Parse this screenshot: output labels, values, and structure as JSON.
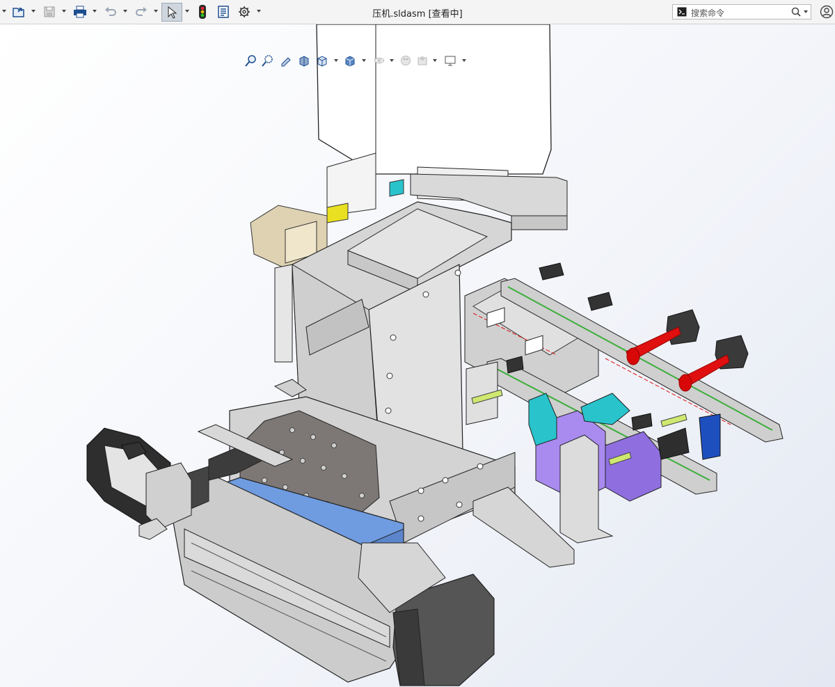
{
  "window": {
    "title": "压机.sldasm [查看中]"
  },
  "toolbar": {
    "items": [
      {
        "name": "open-icon"
      },
      {
        "name": "save-icon"
      },
      {
        "name": "print-icon"
      },
      {
        "name": "undo-icon"
      },
      {
        "name": "redo-icon"
      },
      {
        "name": "select-pointer-icon"
      },
      {
        "name": "rebuild-traffic-light-icon"
      },
      {
        "name": "file-properties-icon"
      },
      {
        "name": "options-gear-icon"
      }
    ]
  },
  "search": {
    "placeholder": "搜索命令"
  },
  "heads_up_toolbar": {
    "items": [
      "zoom-to-fit-icon",
      "zoom-to-area-icon",
      "previous-view-icon",
      "section-view-icon",
      "view-orientation-icon",
      "display-style-icon",
      "hide-show-items-icon",
      "edit-appearance-icon",
      "apply-scene-icon",
      "view-settings-icon"
    ]
  },
  "colors": {
    "accent_blue": "#6f9be0",
    "frame_gray": "#d8d8d8",
    "rail_green": "#3cae3c",
    "laser_red": "#e01010",
    "cyan_block": "#29c3cc",
    "purple_block": "#a98bf0",
    "yellow_part": "#e8e020"
  }
}
